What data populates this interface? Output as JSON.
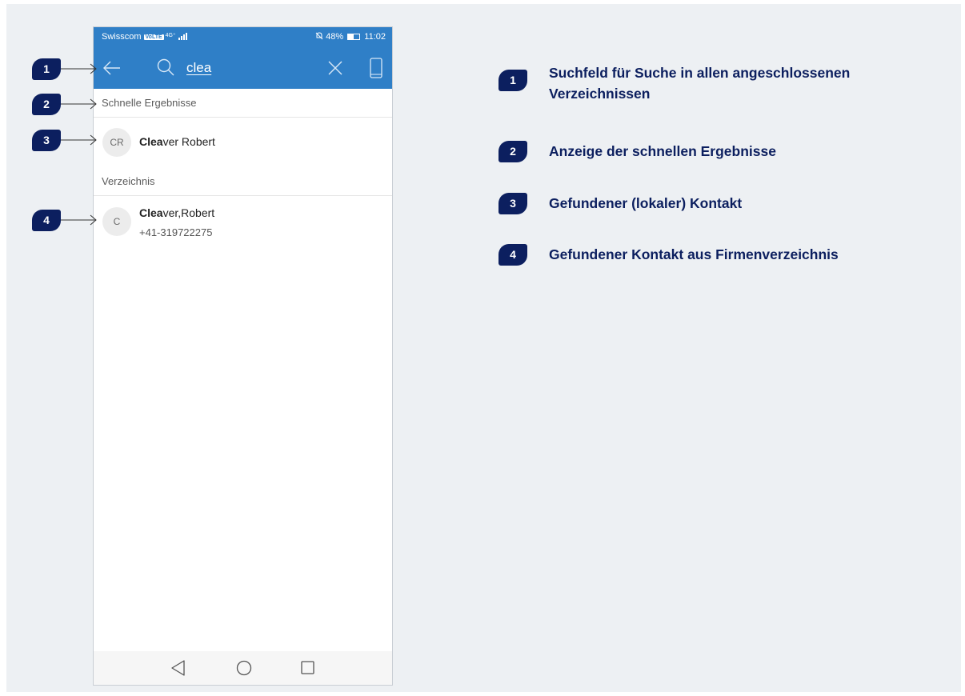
{
  "status_bar": {
    "carrier": "Swisscom",
    "volte": "VoLTE",
    "network": "4G⁺",
    "battery_percent": "48%",
    "time": "11:02"
  },
  "search": {
    "query": "clea"
  },
  "sections": {
    "quick_results_label": "Schnelle Ergebnisse",
    "directory_label": "Verzeichnis"
  },
  "quick_result": {
    "initials": "CR",
    "name_match": "Clea",
    "name_rest": "ver Robert"
  },
  "directory_result": {
    "initials": "C",
    "name_match": "Clea",
    "name_rest": "ver,Robert",
    "phone": "+41-319722275"
  },
  "callouts": {
    "c1": "1",
    "c2": "2",
    "c3": "3",
    "c4": "4"
  },
  "legend": [
    {
      "number": "1",
      "text": "Suchfeld für Suche in allen angeschlossenen Verzeichnissen"
    },
    {
      "number": "2",
      "text": "Anzeige der schnellen Ergebnisse"
    },
    {
      "number": "3",
      "text": "Gefundener (lokaler) Kontakt"
    },
    {
      "number": "4",
      "text": "Gefundener Kontakt aus Firmenverzeichnis"
    }
  ],
  "colors": {
    "app_bar": "#2f7fc7",
    "callout_navy": "#0c1f5f",
    "panel_bg": "#edf0f3"
  }
}
